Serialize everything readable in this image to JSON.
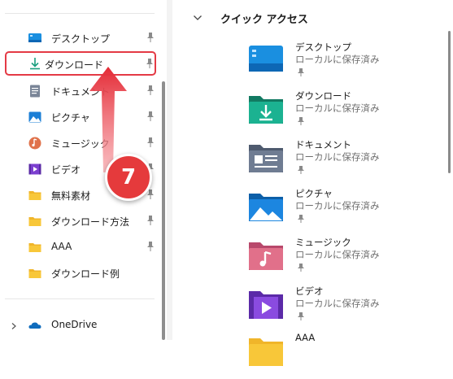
{
  "nav": {
    "items": [
      {
        "label": "デスクトップ",
        "icon": "desktop-icon",
        "pinned": true
      },
      {
        "label": "ダウンロード",
        "icon": "download-icon",
        "pinned": true,
        "selected": true
      },
      {
        "label": "ドキュメント",
        "icon": "document-icon",
        "pinned": true
      },
      {
        "label": "ピクチャ",
        "icon": "pictures-icon",
        "pinned": true
      },
      {
        "label": "ミュージック",
        "icon": "music-icon",
        "pinned": true
      },
      {
        "label": "ビデオ",
        "icon": "video-icon",
        "pinned": true
      },
      {
        "label": "無料素材",
        "icon": "folder-icon",
        "pinned": true
      },
      {
        "label": "ダウンロード方法",
        "icon": "folder-icon",
        "pinned": true
      },
      {
        "label": "AAA",
        "icon": "folder-icon",
        "pinned": true
      },
      {
        "label": "ダウンロード例",
        "icon": "folder-icon",
        "pinned": false
      }
    ],
    "onedrive": {
      "label": "OneDrive",
      "icon": "onedrive-icon"
    }
  },
  "quick_access": {
    "title": "クイック アクセス",
    "tiles": [
      {
        "name": "デスクトップ",
        "status": "ローカルに保存済み",
        "icon": "desktop-icon"
      },
      {
        "name": "ダウンロード",
        "status": "ローカルに保存済み",
        "icon": "download-icon"
      },
      {
        "name": "ドキュメント",
        "status": "ローカルに保存済み",
        "icon": "document-icon"
      },
      {
        "name": "ピクチャ",
        "status": "ローカルに保存済み",
        "icon": "pictures-icon"
      },
      {
        "name": "ミュージック",
        "status": "ローカルに保存済み",
        "icon": "music-icon"
      },
      {
        "name": "ビデオ",
        "status": "ローカルに保存済み",
        "icon": "video-icon"
      },
      {
        "name": "AAA",
        "status": "",
        "icon": "folder-icon"
      }
    ]
  },
  "annotation": {
    "step_number": "7"
  },
  "colors": {
    "highlight_border": "#e43a45",
    "badge_red": "#e53a3c",
    "folder_yellow": "#f8c739",
    "download_green": "#1a9e7e",
    "desktop_blue": "#0f8ee0"
  }
}
